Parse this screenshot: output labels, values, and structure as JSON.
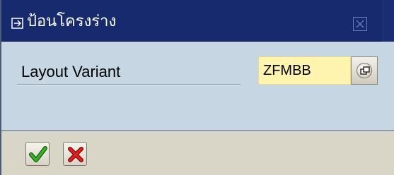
{
  "window": {
    "title": "ป้อนโครงร่าง",
    "icons": {
      "title": "enter-arrow-icon",
      "close": "close-icon"
    }
  },
  "form": {
    "layout_variant_label": "Layout Variant",
    "layout_variant_value": "ZFMBB",
    "help_icon": "possible-entries-icon"
  },
  "toolbar": {
    "ok_icon": "checkmark-icon",
    "cancel_icon": "cancel-x-icon"
  },
  "colors": {
    "title_bar": "#172a6e",
    "content_bg": "#c6d6e2",
    "field_bg": "#fff3b0",
    "ok_green": "#2e9a1e",
    "cancel_red": "#d01818"
  }
}
